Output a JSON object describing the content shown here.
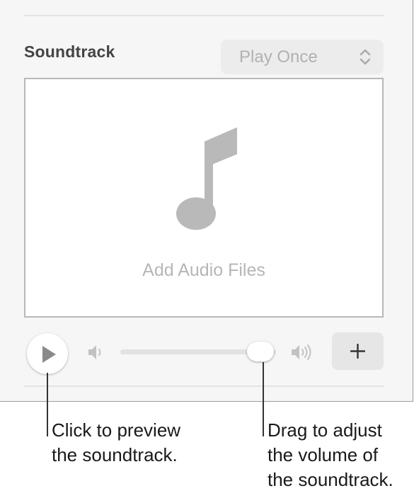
{
  "panel": {
    "section_title": "Soundtrack",
    "playback_mode": {
      "selected": "Play Once",
      "icon": "up-down-chevrons-icon"
    },
    "drop_area": {
      "icon": "music-note-icon",
      "label": "Add Audio Files"
    },
    "controls": {
      "play_icon": "play-icon",
      "volume_low_icon": "speaker-low-icon",
      "volume_high_icon": "speaker-high-icon",
      "volume_level": 0.9,
      "add_icon": "plus-icon"
    }
  },
  "callouts": {
    "preview": "Click to preview\nthe soundtrack.",
    "volume": "Drag to adjust\nthe volume of\nthe soundtrack."
  },
  "colors": {
    "panel_bg": "#f6f6f6",
    "placeholder_gray": "#b6b6b6",
    "accent_gray": "#e6e6e6"
  }
}
